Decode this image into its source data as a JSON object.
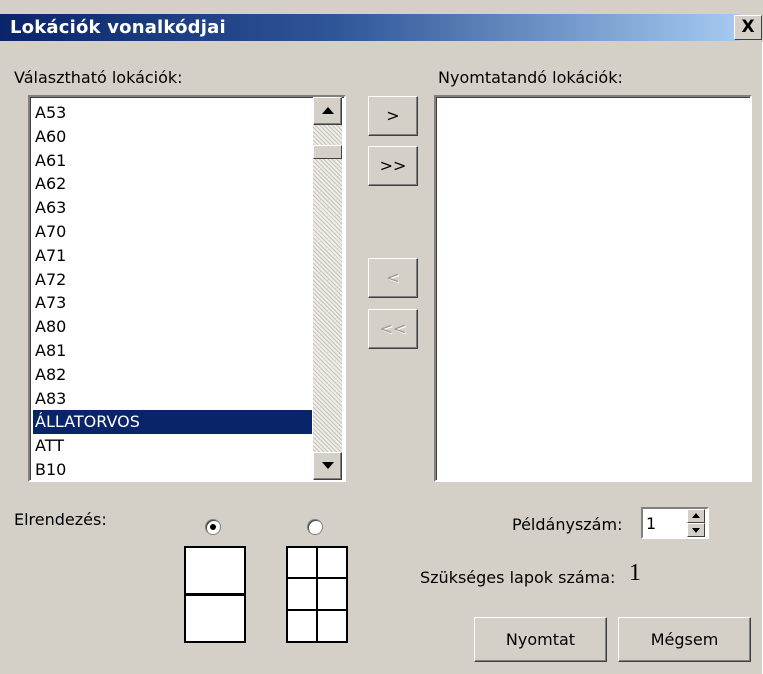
{
  "window": {
    "title": "Lokációk vonalkódjai",
    "close_glyph": "X"
  },
  "available": {
    "label": "Választható lokációk:",
    "items": [
      "A53",
      "A60",
      "A61",
      "A62",
      "A63",
      "A70",
      "A71",
      "A72",
      "A73",
      "A80",
      "A81",
      "A82",
      "A83",
      "ÁLLATORVOS",
      "ATT",
      "B10"
    ],
    "selected_item": "ÁLLATORVOS"
  },
  "printable": {
    "label": "Nyomtatandó lokációk:",
    "items": []
  },
  "transfer_buttons": {
    "add_one": ">",
    "add_all": ">>",
    "remove_one": "<",
    "remove_all": "<<"
  },
  "layout": {
    "label": "Elrendezés:",
    "options": [
      {
        "name": "2 per page",
        "selected": true
      },
      {
        "name": "6 per page",
        "selected": false
      }
    ]
  },
  "copies": {
    "label": "Példányszám:",
    "value": "1"
  },
  "pages_needed": {
    "label": "Szükséges lapok száma:",
    "value": "1"
  },
  "actions": {
    "print_label": "Nyomtat",
    "cancel_label": "Mégsem"
  },
  "colors": {
    "title_gradient_start": "#0a246a",
    "title_gradient_end": "#a6caf0",
    "dialog_face": "#d4d0c8",
    "selection": "#0a246a"
  }
}
